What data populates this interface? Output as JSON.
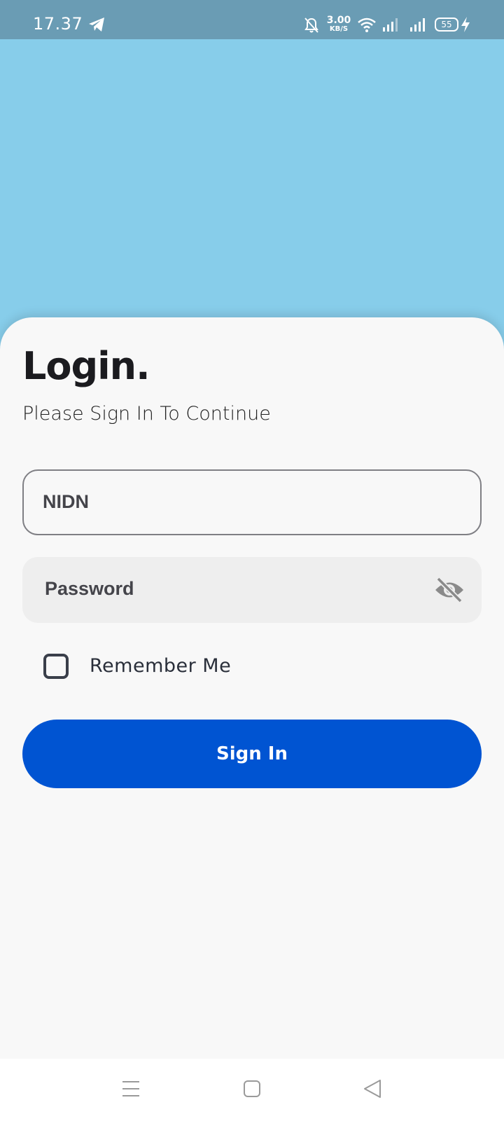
{
  "status_bar": {
    "time": "17.37",
    "net_speed_value": "3.00",
    "net_speed_unit": "KB/S",
    "battery_level": "55",
    "icons": [
      "telegram-icon",
      "bell-off-icon",
      "wifi-icon",
      "signal-icon",
      "signal-icon",
      "battery-icon",
      "bolt-icon"
    ]
  },
  "login": {
    "title": "Login.",
    "subtitle": "Please Sign In To Continue",
    "nidn_placeholder": "NIDN",
    "password_placeholder": "Password",
    "remember_label": "Remember Me",
    "remember_checked": false,
    "signin_label": "Sign In"
  },
  "nav_bar": {
    "icons": [
      "menu-icon",
      "home-icon",
      "back-icon"
    ]
  },
  "colors": {
    "background": "#87CDEA",
    "status_bar": "#6A9CB4",
    "card": "#F8F8F8",
    "primary_button": "#0054D2",
    "password_field_bg": "#EEEEEE"
  }
}
